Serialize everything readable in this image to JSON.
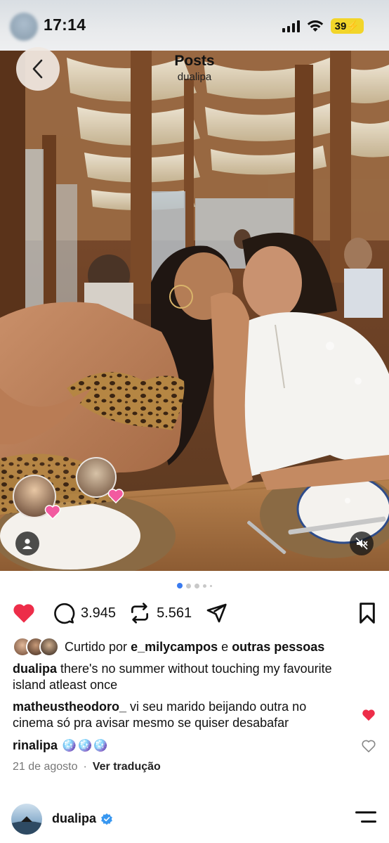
{
  "status_bar": {
    "time": "17:14",
    "battery": "39"
  },
  "header": {
    "title": "Posts",
    "username": "dualipa"
  },
  "post": {
    "likes_liked": true,
    "comments_count": "3.945",
    "reposts_count": "5.561",
    "carousel": {
      "total": 5,
      "active": 1
    },
    "liked_by": {
      "prefix": "Curtido por",
      "user": "e_milycampos",
      "joiner": "e",
      "suffix": "outras pessoas"
    },
    "caption": {
      "user": "dualipa",
      "text": "there's no summer without touching my favourite island atleast once"
    },
    "comments": [
      {
        "user": "matheustheodoro_",
        "text": "vi seu marido beijando outra no cinema só pra avisar mesmo se quiser desabafar",
        "liked": true
      },
      {
        "user": "rinalipa",
        "text": "🪩🪩🪩",
        "liked": false
      }
    ],
    "date": "21 de agosto",
    "translate": "Ver tradução"
  },
  "next_post": {
    "username": "dualipa",
    "verified": true
  },
  "colors": {
    "like_red": "#ed2d49",
    "verified_blue": "#3897f0",
    "battery_yellow": "#f2d52a",
    "dot_active": "#3a7bf0"
  },
  "icons": [
    "back-chevron-icon",
    "heart-icon",
    "comment-icon",
    "repost-icon",
    "share-icon",
    "bookmark-icon",
    "person-tag-icon",
    "mute-icon",
    "verified-icon",
    "menu-icon",
    "signal-icon",
    "wifi-icon"
  ]
}
